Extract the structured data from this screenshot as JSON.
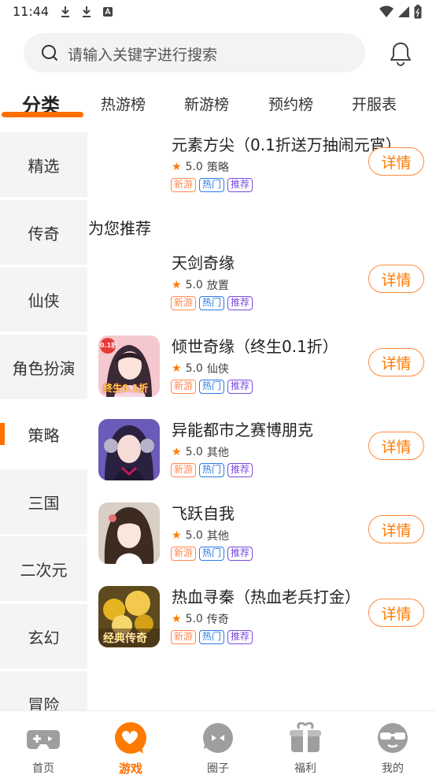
{
  "status_bar": {
    "time": "11:44"
  },
  "search": {
    "placeholder": "请输入关键字进行搜索"
  },
  "tabs": [
    {
      "label": "分类",
      "active": true
    },
    {
      "label": "热游榜",
      "active": false
    },
    {
      "label": "新游榜",
      "active": false
    },
    {
      "label": "预约榜",
      "active": false
    },
    {
      "label": "开服表",
      "active": false
    }
  ],
  "categories": [
    {
      "label": "精选"
    },
    {
      "label": "传奇"
    },
    {
      "label": "仙侠"
    },
    {
      "label": "角色扮演"
    },
    {
      "label": "策略",
      "active": true
    },
    {
      "label": "三国"
    },
    {
      "label": "二次元"
    },
    {
      "label": "玄幻"
    },
    {
      "label": "冒险"
    }
  ],
  "recommend_title": "为您推荐",
  "detail_label": "详情",
  "tag_labels": {
    "new": "新游",
    "hot": "热门",
    "rec": "推荐"
  },
  "games": [
    {
      "name": "元素方尖（0.1折送万抽闹元宵）",
      "rating": "5.0",
      "genre": "策略",
      "icon": "none"
    },
    {
      "name": "天剑奇缘",
      "rating": "5.0",
      "genre": "放置",
      "icon": "none"
    },
    {
      "name": "倾世奇缘（终生0.1折）",
      "rating": "5.0",
      "genre": "仙侠",
      "icon": "anime-girl-pink",
      "icon_text": "终生0.1折",
      "icon_badge": "0.1折"
    },
    {
      "name": "异能都市之赛博朋克",
      "rating": "5.0",
      "genre": "其他",
      "icon": "anime-girl-purple"
    },
    {
      "name": "飞跃自我",
      "rating": "5.0",
      "genre": "其他",
      "icon": "anime-girl-brown"
    },
    {
      "name": "热血寻秦（热血老兵打金）",
      "rating": "5.0",
      "genre": "传奇",
      "icon": "gold-coins",
      "icon_text": "经典传奇"
    }
  ],
  "bottom_nav": [
    {
      "label": "首页",
      "icon": "gamepad-icon"
    },
    {
      "label": "游戏",
      "icon": "game-chat-icon",
      "active": true
    },
    {
      "label": "圈子",
      "icon": "circle-chat-icon"
    },
    {
      "label": "福利",
      "icon": "gift-icon"
    },
    {
      "label": "我的",
      "icon": "profile-glasses-icon"
    }
  ],
  "colors": {
    "accent": "#ff6f00",
    "tag_new": "#ff8a50",
    "tag_hot": "#2c7be5",
    "tag_rec": "#7a4be0"
  }
}
